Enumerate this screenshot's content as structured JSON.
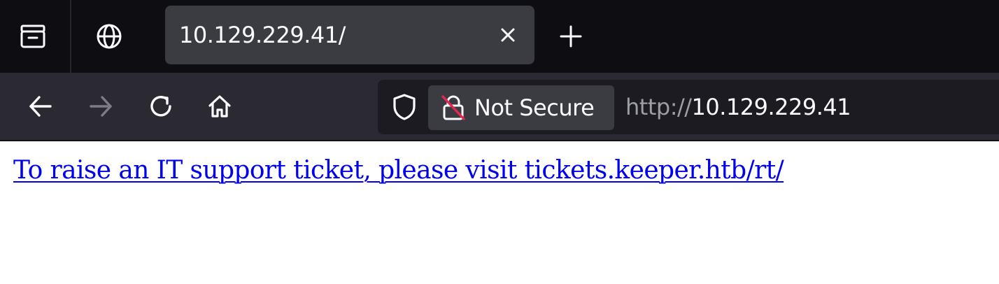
{
  "browser": {
    "tab": {
      "title": "10.129.229.41/",
      "close_symbol": "×",
      "new_tab_symbol": "+"
    },
    "toolbar_icons": [
      "tab-overview-icon",
      "globe-icon"
    ],
    "nav": {
      "back_icon": "arrow-left-icon",
      "forward_icon": "arrow-right-icon",
      "reload_icon": "reload-icon",
      "home_icon": "home-icon"
    },
    "urlbar": {
      "security_label": "Not Secure",
      "scheme": "http://",
      "host": "10.129.229.41"
    }
  },
  "page": {
    "link_text": "To raise an IT support ticket, please visit tickets.keeper.htb/rt/"
  },
  "colors": {
    "tabbar_bg": "#0e0e12",
    "active_tab_bg": "#3b3b42",
    "navbar_bg": "#2b2a33",
    "urlbar_bg": "#1c1b22",
    "link": "#0000ee",
    "insecure_slash": "#e22850"
  }
}
